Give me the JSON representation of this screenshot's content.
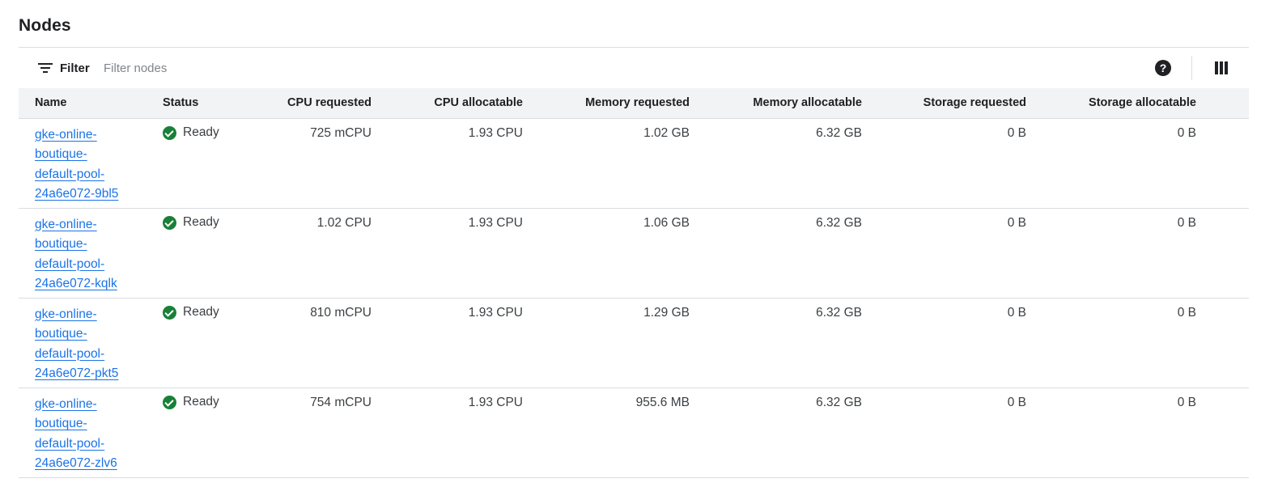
{
  "page": {
    "title": "Nodes"
  },
  "toolbar": {
    "filter_label": "Filter",
    "filter_placeholder": "Filter nodes",
    "filter_value": "",
    "help_icon": "help-circle-icon",
    "columns_icon": "view-columns-icon"
  },
  "table": {
    "columns": [
      "Name",
      "Status",
      "CPU requested",
      "CPU allocatable",
      "Memory requested",
      "Memory allocatable",
      "Storage requested",
      "Storage allocatable"
    ],
    "rows": [
      {
        "name_lines": [
          "gke-online-",
          "boutique-",
          "default-pool-",
          "24a6e072-9bl5"
        ],
        "status": "Ready",
        "cpu_requested": "725 mCPU",
        "cpu_allocatable": "1.93 CPU",
        "memory_requested": "1.02 GB",
        "memory_allocatable": "6.32 GB",
        "storage_requested": "0 B",
        "storage_allocatable": "0 B"
      },
      {
        "name_lines": [
          "gke-online-",
          "boutique-",
          "default-pool-",
          "24a6e072-kqlk"
        ],
        "status": "Ready",
        "cpu_requested": "1.02 CPU",
        "cpu_allocatable": "1.93 CPU",
        "memory_requested": "1.06 GB",
        "memory_allocatable": "6.32 GB",
        "storage_requested": "0 B",
        "storage_allocatable": "0 B"
      },
      {
        "name_lines": [
          "gke-online-",
          "boutique-",
          "default-pool-",
          "24a6e072-pkt5"
        ],
        "status": "Ready",
        "cpu_requested": "810 mCPU",
        "cpu_allocatable": "1.93 CPU",
        "memory_requested": "1.29 GB",
        "memory_allocatable": "6.32 GB",
        "storage_requested": "0 B",
        "storage_allocatable": "0 B"
      },
      {
        "name_lines": [
          "gke-online-",
          "boutique-",
          "default-pool-",
          "24a6e072-zlv6"
        ],
        "status": "Ready",
        "cpu_requested": "754 mCPU",
        "cpu_allocatable": "1.93 CPU",
        "memory_requested": "955.6 MB",
        "memory_allocatable": "6.32 GB",
        "storage_requested": "0 B",
        "storage_allocatable": "0 B"
      }
    ]
  },
  "colors": {
    "link": "#1a73e8",
    "status_ok": "#188038",
    "header_bg": "#f1f3f4",
    "divider": "#dadce0"
  }
}
